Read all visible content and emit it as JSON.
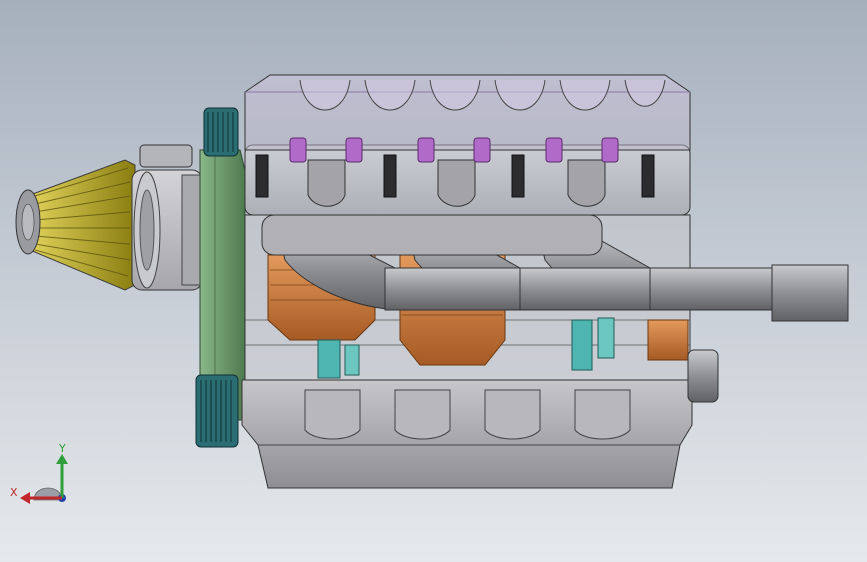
{
  "viewport": {
    "background_top": "#a6b0bd",
    "background_bottom": "#e6e9ec"
  },
  "model": {
    "colors": {
      "valve_cover_glass": "#d9cfe6",
      "head_gray": "#b8b8bc",
      "outline": "#3a3a3a",
      "exhaust": "#8d8e92",
      "piston_copper": "#c9753a",
      "rod_cyan": "#4fb5b0",
      "pulley_teal": "#1e5f66",
      "timing_cover_green": "#6b9b6a",
      "filter_yellow": "#c9b92a",
      "rocker_purple": "#b06bc8"
    }
  },
  "triad": {
    "x_label": "X",
    "y_label": "Y",
    "x_color": "#c0272d",
    "y_color": "#2f9e3a",
    "z_color": "#2244aa"
  }
}
